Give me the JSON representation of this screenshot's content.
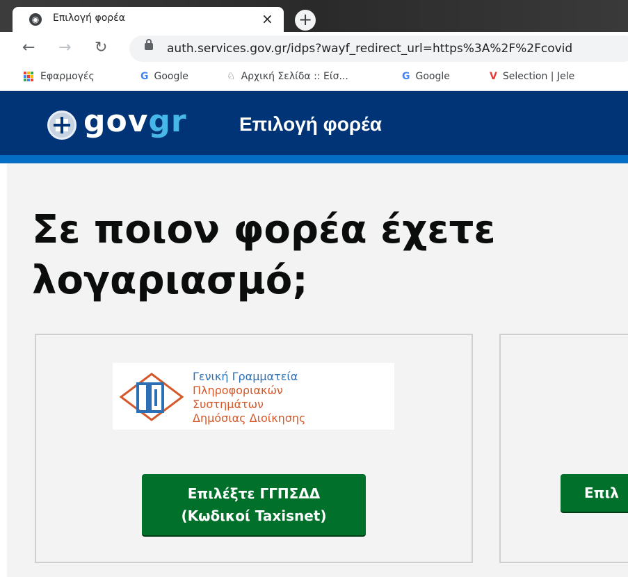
{
  "browser": {
    "tab_title": "Επιλογή φορέα",
    "tab_close": "×",
    "new_tab": "+",
    "url": "auth.services.gov.gr/idps?wayf_redirect_url=https%3A%2F%2Fcovid",
    "bookmarks": [
      {
        "label": "Εφαρμογές",
        "icon": "apps-grid-icon"
      },
      {
        "label": "Google",
        "icon": "google-icon"
      },
      {
        "label": "Αρχική Σελίδα :: Είσ...",
        "icon": "site-icon"
      },
      {
        "label": "Google",
        "icon": "google-icon"
      },
      {
        "label": "Selection | Jele",
        "icon": "v-logo-icon"
      }
    ]
  },
  "header": {
    "logo_gov": "gov",
    "logo_gr": "gr",
    "title": "Επιλογή φορέα"
  },
  "main": {
    "heading": "Σε ποιον φορέα έχετε λογαριασμό;",
    "cards": [
      {
        "logo_lines": [
          "Γενική Γραμματεία",
          "Πληροφοριακών",
          "Συστημάτων",
          "Δημόσιας Διοίκησης"
        ],
        "button_line1": "Επιλέξτε ΓΓΠΣΔΔ",
        "button_line2": "(Κωδικοί Taxisnet)"
      },
      {
        "button_label": "Επιλ"
      }
    ]
  },
  "colors": {
    "header_bg": "#003476",
    "header_stripe": "#046ec5",
    "button_bg": "#00702b",
    "logo_accent": "#46b7e8"
  }
}
